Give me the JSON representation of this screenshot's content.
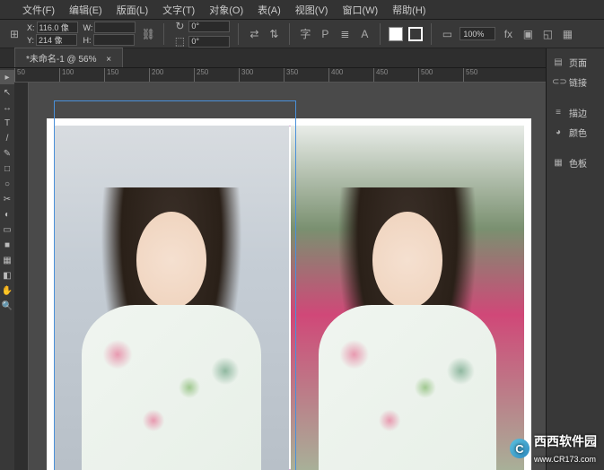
{
  "menu": {
    "items": [
      "文件(F)",
      "编辑(E)",
      "版面(L)",
      "文字(T)",
      "对象(O)",
      "表(A)",
      "视图(V)",
      "窗口(W)",
      "帮助(H)"
    ]
  },
  "options": {
    "x_label": "X:",
    "x_value": "116.0 像",
    "y_label": "Y:",
    "y_value": "214 像",
    "w_label": "W:",
    "w_value": "",
    "h_label": "H:",
    "h_value": "",
    "rotate": "0°",
    "shear": "0°",
    "char_glyph": "字",
    "para_glyph": "P",
    "a_glyph": "A",
    "zoom": "100%",
    "fx_glyph": "fx"
  },
  "tab": {
    "title": "*未命名-1 @ 56%",
    "close": "×"
  },
  "ruler_h": [
    "50",
    "100",
    "150",
    "200",
    "250",
    "300",
    "350",
    "400",
    "450",
    "500",
    "550"
  ],
  "tools": [
    "▸",
    "↖",
    "↔",
    "T",
    "/",
    "✎",
    "□",
    "○",
    "✂",
    "◐",
    "▭",
    "■",
    "▦",
    "◧",
    "✋",
    "🔍"
  ],
  "panels": {
    "items": [
      {
        "icon": "▤",
        "label": "页面"
      },
      {
        "icon": "⊂⊃",
        "label": "链接"
      },
      {
        "gap": true
      },
      {
        "icon": "≡",
        "label": "描边"
      },
      {
        "icon": "◕",
        "label": "颜色"
      },
      {
        "gap": true
      },
      {
        "icon": "▦",
        "label": "色板"
      }
    ]
  },
  "watermark": {
    "brand": "西西软件园",
    "url": "www.CR173.com"
  }
}
